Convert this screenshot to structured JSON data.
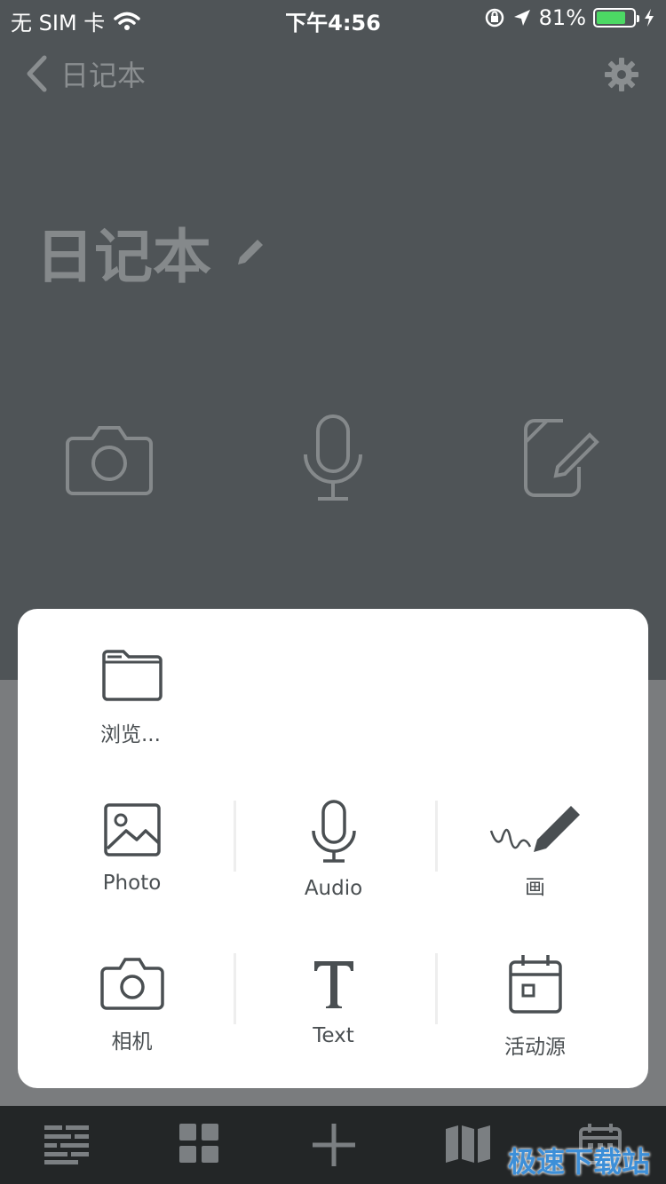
{
  "status_bar": {
    "carrier": "无 SIM 卡",
    "time": "下午4:56",
    "battery_percent": "81%",
    "battery_level": 0.81,
    "icons": [
      "wifi-icon",
      "orientation-lock-icon",
      "location-arrow-icon",
      "battery-icon",
      "charging-bolt-icon"
    ]
  },
  "nav": {
    "back_label": "日记本",
    "settings_icon": "gear-icon"
  },
  "page": {
    "title": "日记本",
    "edit_icon": "pencil-icon"
  },
  "quick_actions": [
    {
      "icon": "camera-icon"
    },
    {
      "icon": "microphone-icon"
    },
    {
      "icon": "edit-note-icon"
    }
  ],
  "panel": {
    "browse": {
      "label": "浏览...",
      "icon": "folder-icon"
    },
    "row1": [
      {
        "label": "Photo",
        "icon": "image-icon"
      },
      {
        "label": "Audio",
        "icon": "microphone-icon"
      },
      {
        "label": "画",
        "icon": "draw-pencil-icon"
      }
    ],
    "row2": [
      {
        "label": "相机",
        "icon": "camera-icon"
      },
      {
        "label": "Text",
        "icon": "text-t-icon"
      },
      {
        "label": "活动源",
        "icon": "calendar-icon"
      }
    ]
  },
  "tab_bar": {
    "tabs": [
      "list-icon",
      "grid-icon",
      "plus-icon",
      "map-icon",
      "calendar-icon"
    ]
  },
  "watermark": "极速下载站",
  "colors": {
    "background": "#4f5457",
    "dim": "#7a7c7e",
    "panel": "#ffffff",
    "icon_dark": "#4a4f52",
    "tab_bar": "#232627",
    "battery_green": "#4cd964",
    "watermark": "#3d8fd8"
  }
}
